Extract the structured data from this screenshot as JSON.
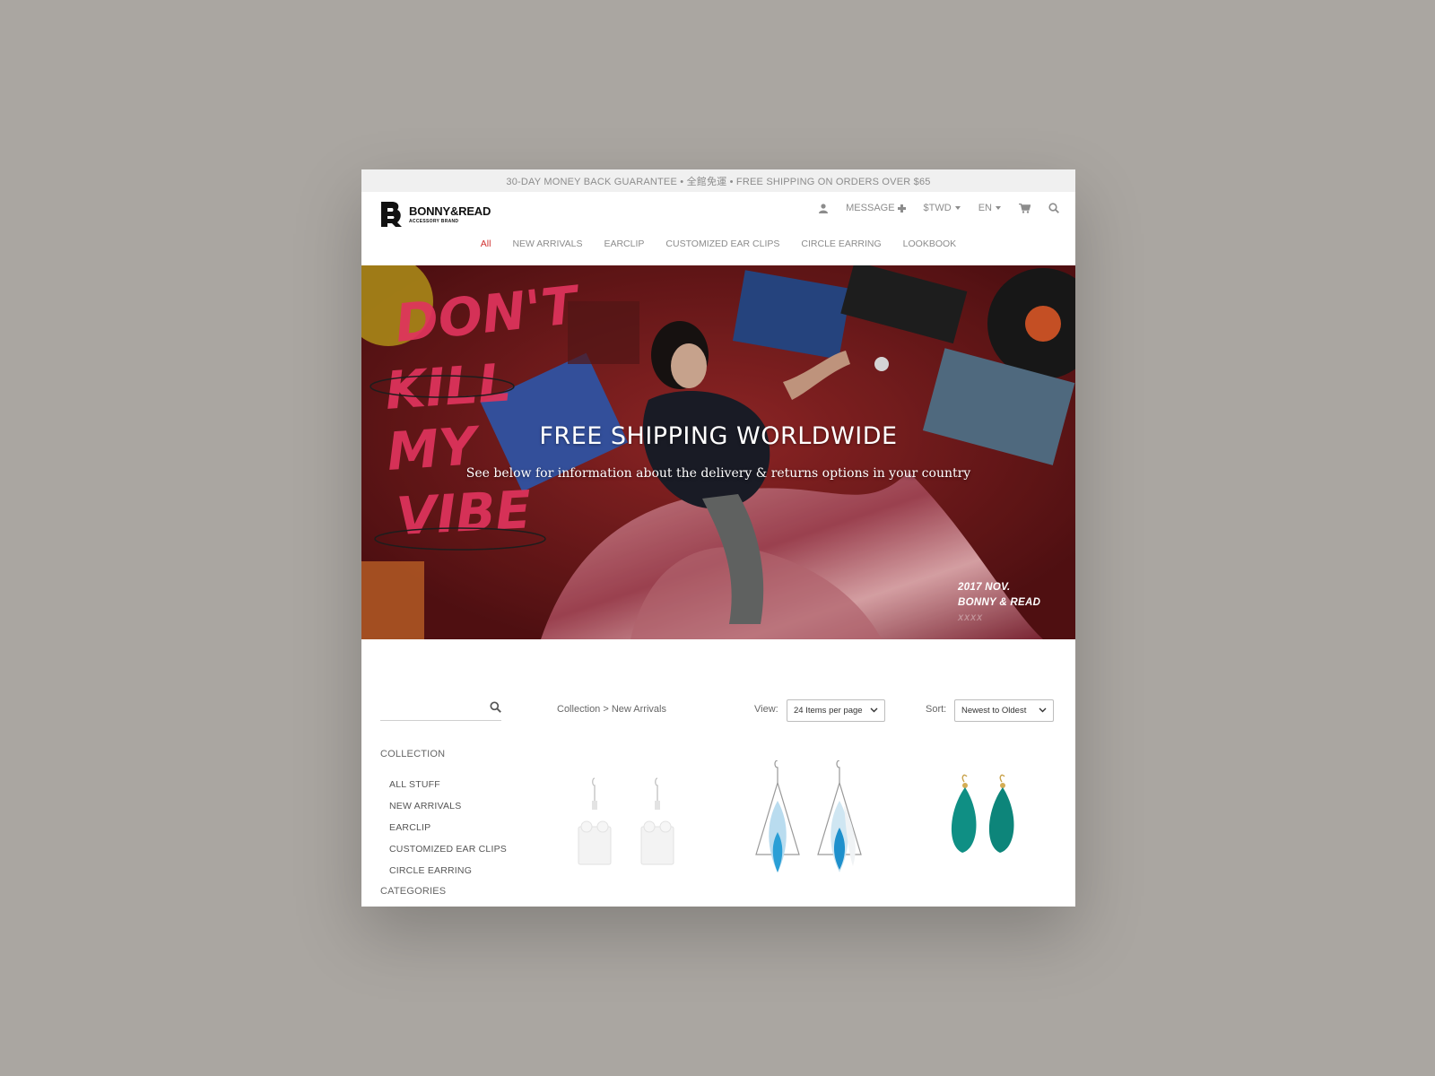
{
  "promo_bar": {
    "text": "30-DAY MONEY BACK GUARANTEE • 全館免運 • FREE SHIPPING ON ORDERS OVER $65"
  },
  "header": {
    "brand_name": "BONNY&READ",
    "brand_tagline": "ACCESSORY BRAND",
    "message_label": "MESSAGE",
    "currency_label": "$TWD",
    "language_label": "EN",
    "icons": [
      "user-icon",
      "plus-icon",
      "cart-icon",
      "search-icon"
    ]
  },
  "nav": {
    "items": [
      {
        "label": "All",
        "active": true
      },
      {
        "label": "NEW ARRIVALS"
      },
      {
        "label": "EARCLIP"
      },
      {
        "label": "CUSTOMIZED EAR CLIPS"
      },
      {
        "label": "CIRCLE EARRING"
      },
      {
        "label": "LOOKBOOK"
      }
    ],
    "active_color": "#d0302f"
  },
  "hero": {
    "title": "FREE SHIPPING WORLDWIDE",
    "subtitle": "See below for information about the delivery & returns options in your country",
    "artwork_text": "DON'T KILL MY VIBE",
    "stamp_line1": "2017 NOV.",
    "stamp_line2": "BONNY & READ",
    "stamp_line3": "XXXX"
  },
  "toolbar": {
    "search_placeholder": "",
    "breadcrumb": "Collection > New Arrivals",
    "view_label": "View:",
    "view_value": "24 Items per page",
    "sort_label": "Sort:",
    "sort_value": "Newest to Oldest"
  },
  "sidebar": {
    "collection_heading": "COLLECTION",
    "items": [
      {
        "label": "ALL STUFF"
      },
      {
        "label": "NEW ARRIVALS"
      },
      {
        "label": "EARCLIP"
      },
      {
        "label": "CUSTOMIZED EAR CLIPS"
      },
      {
        "label": "CIRCLE EARRING"
      }
    ],
    "categories_heading": "CATEGORIES"
  },
  "products": [
    {
      "name": "white-block-earrings",
      "color": "#f4f4f4"
    },
    {
      "name": "blue-feather-triangle-earrings",
      "color": "#3fa9d6"
    },
    {
      "name": "teal-feather-earrings",
      "color": "#0f8f84"
    }
  ]
}
